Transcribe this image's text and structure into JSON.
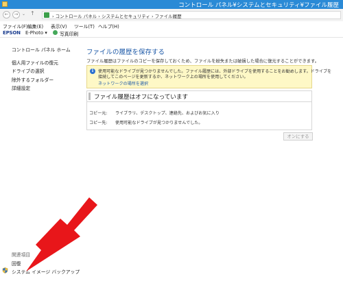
{
  "window": {
    "title": "コントロール パネル¥システムとセキュリティ¥ファイル履歴"
  },
  "address": {
    "back": "←",
    "forward": "→",
    "recent": "⌄",
    "up": "↑",
    "crumbs": "›  コントロール パネル  ›  システムとセキュリティ  ›  ファイル履歴"
  },
  "menu": [
    "ファイル(F)",
    "編集(E)",
    "表示(V)",
    "ツール(T)",
    "ヘルプ(H)"
  ],
  "toolbar": {
    "brand": "EPSON",
    "product": "E-Photo",
    "dropdown": "▾",
    "print": "写真印刷"
  },
  "sidebar": {
    "home": "コントロール パネル ホーム",
    "items": [
      "個人用ファイルの復元",
      "ドライブの選択",
      "除外するフォルダー",
      "詳細設定"
    ],
    "related_header": "関連項目",
    "related": [
      "回復",
      "システム イメージ バックアップ"
    ]
  },
  "main": {
    "heading": "ファイルの履歴を保存する",
    "description": "ファイル履歴はファイルのコピーを保存しておくため、ファイルを紛失または破損した場合に復元することができます。",
    "warning": {
      "icon": "i",
      "line1": "使用可能なドライブが見つかりませんでした。ファイル履歴には、外部ドライブを使用することをお勧めします。ドライブを",
      "line2": "接続してこのページを更新するか、ネットワーク上の場所を使用してください。",
      "link": "ネットワークの場所を選択"
    },
    "status": {
      "title": "ファイル履歴はオフになっています",
      "copy_from_label": "コピー元:",
      "copy_from_value": "ライブラリ、デスクトップ、連絡先、およびお気に入り",
      "copy_to_label": "コピー先:",
      "copy_to_value": "使用可能なドライブが見つかりませんでした。"
    },
    "turn_on": "オンにする"
  },
  "annotation": {
    "color": "#e8161a"
  }
}
